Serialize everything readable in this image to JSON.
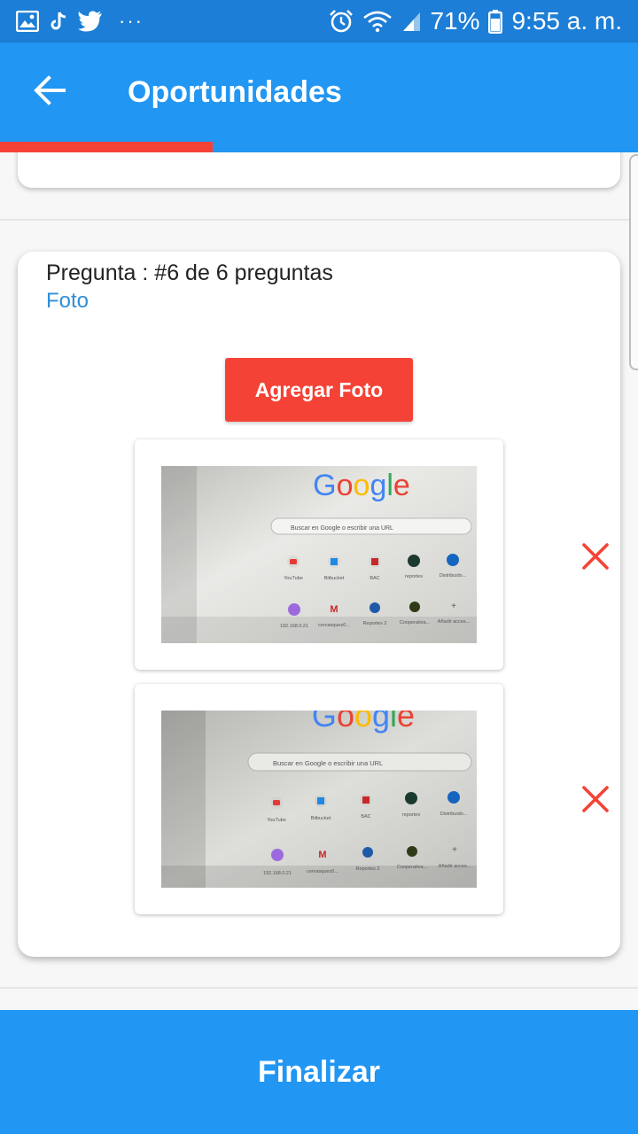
{
  "status_bar": {
    "left_icons": [
      "gallery-icon",
      "tiktok-icon",
      "twitter-icon"
    ],
    "overflow": "···",
    "battery_percent": "71%",
    "time": "9:55 a. m."
  },
  "app_bar": {
    "title": "Oportunidades"
  },
  "progress": {
    "fraction": 0.333
  },
  "question": {
    "header": "Pregunta : #6 de  6 preguntas",
    "type": "Foto",
    "add_photo_label": "Agregar Foto",
    "photos": [
      {
        "logo": "Google",
        "search_placeholder": "Buscar en Google o escribir una URL",
        "shortcuts": [
          "YouTube",
          "Bitbucket",
          "BAC",
          "reportes",
          "Distribuido...",
          "192.168.0.21",
          "cervasquez0...",
          "Reportes 2",
          "Cooperativa...",
          "Añadir acces..."
        ]
      },
      {
        "logo": "Google",
        "search_placeholder": "Buscar en Google o escribir una URL",
        "shortcuts": [
          "YouTube",
          "Bitbucket",
          "BAC",
          "reportes",
          "Distribuido...",
          "192.168.0.21",
          "cervasquez0...",
          "Reportes 2",
          "Cooperativa...",
          "Añadir acces..."
        ]
      }
    ]
  },
  "footer": {
    "finalize_label": "Finalizar"
  },
  "colors": {
    "primary": "#2196f3",
    "status_bar": "#1c7ed6",
    "accent": "#f44336",
    "link": "#2f8fd8"
  }
}
